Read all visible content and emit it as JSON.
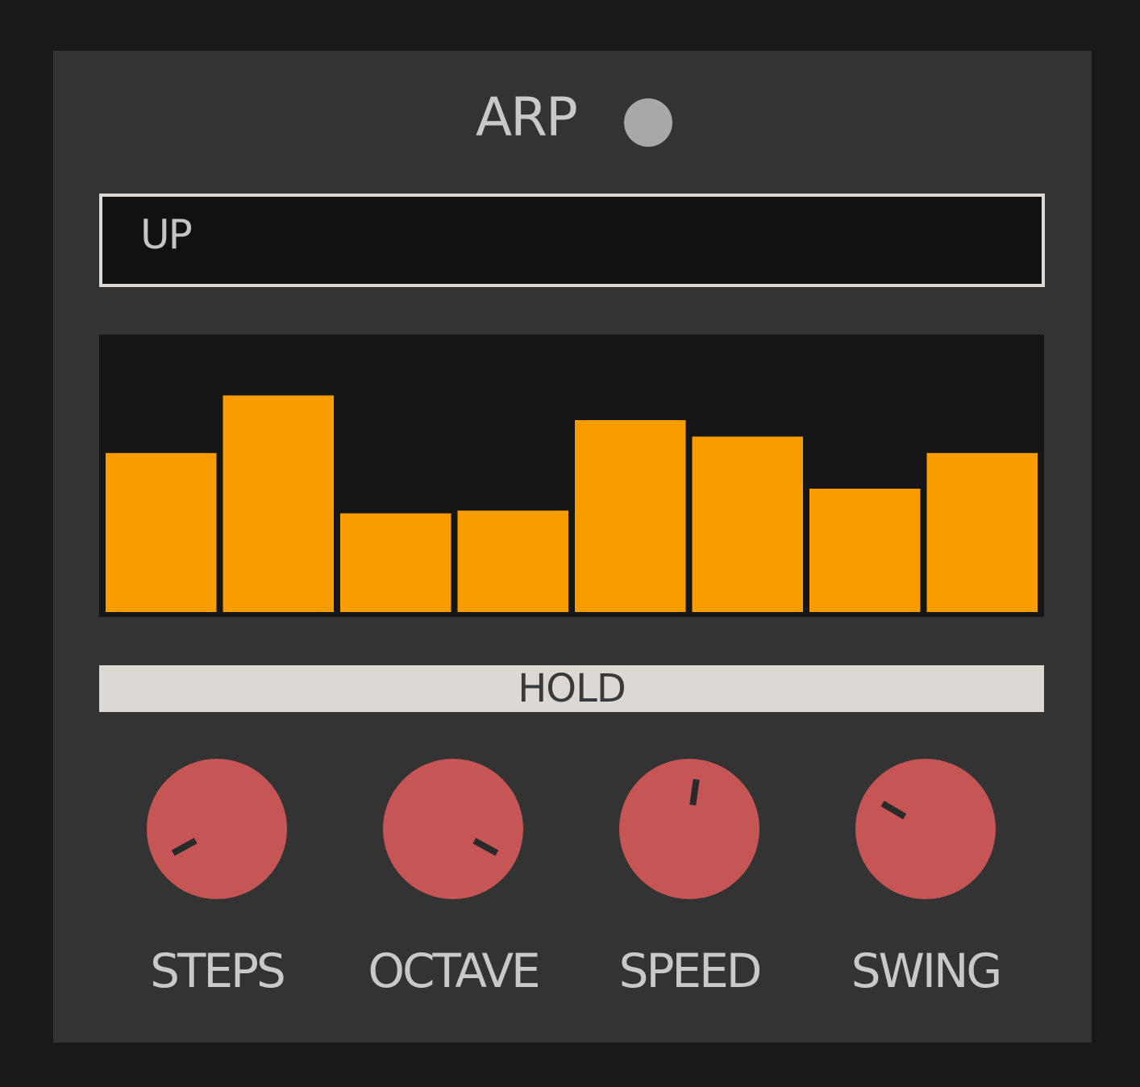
{
  "arp": {
    "title": "ARP",
    "power_led": "off",
    "mode": "UP",
    "hold_label": "HOLD",
    "colors": {
      "panel": "#333333",
      "frame": "#191919",
      "step_bar": "#f89c00",
      "knob": "#c65555",
      "text": "#c9c9c9",
      "hold_bg": "#dcd8d3"
    },
    "steps": {
      "count": 8,
      "levels": [
        0.58,
        0.79,
        0.36,
        0.37,
        0.7,
        0.64,
        0.45,
        0.58
      ]
    },
    "knobs": [
      {
        "name": "steps",
        "label": "STEPS",
        "value": 0.06
      },
      {
        "name": "octave",
        "label": "OCTAVE",
        "value": 0.94
      },
      {
        "name": "speed",
        "label": "SPEED",
        "value": 0.53
      },
      {
        "name": "swing",
        "label": "SWING",
        "value": 0.28
      }
    ]
  }
}
